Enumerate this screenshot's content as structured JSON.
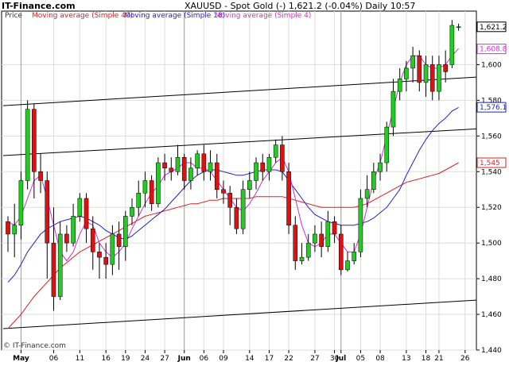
{
  "header": {
    "brand": "IT-Finance.com",
    "title": "XAUUSD - Spot Gold (-)   1,621.2 (-0.04%)   Daily  10:57"
  },
  "legend": {
    "price": "Price",
    "ma40": "Moving average (Simple 40)",
    "ma18": "Moving average (Simple 18)",
    "ma4": "Moving average (Simple 4)"
  },
  "watermark": "© IT-Finance.com",
  "colors": {
    "up": "#22cc22",
    "down": "#dd1111",
    "ma40": "#dd2222",
    "ma18": "#2222cc",
    "ma4": "#cc33cc",
    "channel": "#000000",
    "grid": "#dddddd"
  },
  "chart_data": {
    "type": "candlestick",
    "ylim": [
      1440,
      1630
    ],
    "y_ticks": [
      "1,440",
      "1,460",
      "1,480",
      "1,500",
      "1,520",
      "1,540",
      "1,560",
      "1,580",
      "1,600"
    ],
    "price_labels": {
      "last": "1,621.2",
      "ma4": "1,608.8",
      "ma18": "1,576.1",
      "ma40": "1,545"
    },
    "x_labels": [
      {
        "label": "May",
        "i": 2,
        "bold": true
      },
      {
        "label": "06",
        "i": 7,
        "bold": false
      },
      {
        "label": "11",
        "i": 11,
        "bold": false
      },
      {
        "label": "16",
        "i": 15,
        "bold": false
      },
      {
        "label": "19",
        "i": 18,
        "bold": false
      },
      {
        "label": "24",
        "i": 21,
        "bold": false
      },
      {
        "label": "27",
        "i": 24,
        "bold": false
      },
      {
        "label": "Jun",
        "i": 27,
        "bold": true
      },
      {
        "label": "06",
        "i": 30,
        "bold": false
      },
      {
        "label": "09",
        "i": 33,
        "bold": false
      },
      {
        "label": "14",
        "i": 37,
        "bold": false
      },
      {
        "label": "17",
        "i": 40,
        "bold": false
      },
      {
        "label": "22",
        "i": 43,
        "bold": false
      },
      {
        "label": "27",
        "i": 47,
        "bold": false
      },
      {
        "label": "30",
        "i": 50,
        "bold": false
      },
      {
        "label": "Jul",
        "i": 51,
        "bold": true
      },
      {
        "label": "05",
        "i": 54,
        "bold": false
      },
      {
        "label": "08",
        "i": 57,
        "bold": false
      },
      {
        "label": "13",
        "i": 61,
        "bold": false
      },
      {
        "label": "18",
        "i": 64,
        "bold": false
      },
      {
        "label": "21",
        "i": 66,
        "bold": false
      },
      {
        "label": "26",
        "i": 70,
        "bold": false
      }
    ],
    "candles": [
      [
        1512,
        1505,
        1515,
        1495
      ],
      [
        1505,
        1510,
        1522,
        1492
      ],
      [
        1510,
        1535,
        1540,
        1502
      ],
      [
        1535,
        1575,
        1580,
        1530
      ],
      [
        1575,
        1540,
        1578,
        1525
      ],
      [
        1540,
        1535,
        1550,
        1528
      ],
      [
        1535,
        1500,
        1540,
        1480
      ],
      [
        1500,
        1470,
        1520,
        1462
      ],
      [
        1470,
        1505,
        1512,
        1468
      ],
      [
        1505,
        1500,
        1510,
        1495
      ],
      [
        1500,
        1515,
        1522,
        1498
      ],
      [
        1515,
        1525,
        1528,
        1512
      ],
      [
        1525,
        1508,
        1528,
        1500
      ],
      [
        1508,
        1495,
        1515,
        1485
      ],
      [
        1495,
        1492,
        1500,
        1480
      ],
      [
        1492,
        1488,
        1500,
        1480
      ],
      [
        1488,
        1505,
        1510,
        1482
      ],
      [
        1505,
        1498,
        1512,
        1485
      ],
      [
        1498,
        1515,
        1518,
        1490
      ],
      [
        1515,
        1520,
        1525,
        1510
      ],
      [
        1520,
        1528,
        1535,
        1515
      ],
      [
        1528,
        1535,
        1540,
        1520
      ],
      [
        1535,
        1522,
        1538,
        1518
      ],
      [
        1522,
        1545,
        1548,
        1520
      ],
      [
        1545,
        1542,
        1550,
        1535
      ],
      [
        1542,
        1540,
        1548,
        1535
      ],
      [
        1540,
        1548,
        1555,
        1538
      ],
      [
        1548,
        1535,
        1550,
        1530
      ],
      [
        1535,
        1542,
        1548,
        1530
      ],
      [
        1542,
        1550,
        1552,
        1538
      ],
      [
        1550,
        1540,
        1555,
        1535
      ],
      [
        1540,
        1545,
        1552,
        1535
      ],
      [
        1545,
        1530,
        1550,
        1525
      ],
      [
        1530,
        1528,
        1535,
        1522
      ],
      [
        1528,
        1520,
        1532,
        1510
      ],
      [
        1520,
        1508,
        1525,
        1505
      ],
      [
        1508,
        1530,
        1535,
        1505
      ],
      [
        1530,
        1535,
        1540,
        1525
      ],
      [
        1535,
        1545,
        1548,
        1530
      ],
      [
        1545,
        1540,
        1550,
        1535
      ],
      [
        1540,
        1548,
        1550,
        1535
      ],
      [
        1548,
        1555,
        1558,
        1545
      ],
      [
        1555,
        1540,
        1560,
        1535
      ],
      [
        1540,
        1510,
        1545,
        1505
      ],
      [
        1510,
        1490,
        1515,
        1485
      ],
      [
        1490,
        1492,
        1500,
        1488
      ],
      [
        1492,
        1500,
        1505,
        1490
      ],
      [
        1500,
        1505,
        1510,
        1495
      ],
      [
        1505,
        1498,
        1512,
        1492
      ],
      [
        1498,
        1512,
        1518,
        1495
      ],
      [
        1512,
        1505,
        1515,
        1500
      ],
      [
        1505,
        1485,
        1510,
        1482
      ],
      [
        1485,
        1490,
        1495,
        1484
      ],
      [
        1490,
        1495,
        1500,
        1488
      ],
      [
        1495,
        1525,
        1530,
        1492
      ],
      [
        1525,
        1530,
        1538,
        1520
      ],
      [
        1530,
        1540,
        1545,
        1528
      ],
      [
        1540,
        1545,
        1550,
        1535
      ],
      [
        1545,
        1565,
        1568,
        1540
      ],
      [
        1565,
        1585,
        1592,
        1560
      ],
      [
        1585,
        1592,
        1598,
        1580
      ],
      [
        1592,
        1598,
        1602,
        1585
      ],
      [
        1598,
        1605,
        1610,
        1590
      ],
      [
        1605,
        1590,
        1608,
        1585
      ],
      [
        1590,
        1600,
        1605,
        1582
      ],
      [
        1600,
        1585,
        1605,
        1580
      ],
      [
        1585,
        1600,
        1605,
        1580
      ],
      [
        1600,
        1596,
        1608,
        1590
      ],
      [
        1600,
        1622,
        1625,
        1598
      ],
      [
        1621,
        1621.2,
        1623,
        1619
      ]
    ],
    "ma4": [
      1512,
      1510,
      1515,
      1525,
      1535,
      1538,
      1525,
      1510,
      1495,
      1490,
      1495,
      1505,
      1512,
      1510,
      1500,
      1495,
      1492,
      1495,
      1500,
      1508,
      1515,
      1522,
      1528,
      1532,
      1538,
      1540,
      1542,
      1545,
      1545,
      1542,
      1542,
      1540,
      1535,
      1530,
      1525,
      1520,
      1518,
      1522,
      1528,
      1535,
      1540,
      1545,
      1548,
      1540,
      1525,
      1510,
      1500,
      1498,
      1500,
      1505,
      1505,
      1500,
      1495,
      1495,
      1505,
      1520,
      1535,
      1545,
      1560,
      1575,
      1590,
      1600,
      1605,
      1605,
      1600,
      1598,
      1598,
      1600,
      1605,
      1609
    ],
    "ma18": [
      1478,
      1482,
      1488,
      1495,
      1500,
      1505,
      1508,
      1510,
      1512,
      1513,
      1514,
      1515,
      1514,
      1512,
      1510,
      1507,
      1505,
      1503,
      1502,
      1504,
      1507,
      1510,
      1513,
      1516,
      1519,
      1523,
      1527,
      1531,
      1535,
      1538,
      1540,
      1541,
      1541,
      1540,
      1539,
      1538,
      1538,
      1539,
      1540,
      1541,
      1541,
      1541,
      1540,
      1535,
      1530,
      1525,
      1520,
      1516,
      1514,
      1512,
      1511,
      1510,
      1510,
      1510,
      1511,
      1512,
      1514,
      1517,
      1520,
      1525,
      1530,
      1538,
      1545,
      1552,
      1558,
      1563,
      1567,
      1570,
      1574,
      1576
    ],
    "ma40": [
      1452,
      1456,
      1460,
      1465,
      1470,
      1474,
      1478,
      1482,
      1486,
      1489,
      1492,
      1495,
      1497,
      1499,
      1501,
      1503,
      1505,
      1507,
      1509,
      1511,
      1513,
      1515,
      1516,
      1517,
      1518,
      1519,
      1520,
      1521,
      1522,
      1522,
      1523,
      1524,
      1524,
      1525,
      1525,
      1525,
      1525,
      1525,
      1526,
      1526,
      1526,
      1526,
      1526,
      1525,
      1524,
      1523,
      1522,
      1521,
      1520,
      1520,
      1520,
      1520,
      1520,
      1520,
      1521,
      1522,
      1524,
      1526,
      1528,
      1530,
      1532,
      1534,
      1535,
      1536,
      1537,
      1538,
      1539,
      1541,
      1543,
      1545
    ],
    "channel_lines": [
      {
        "i0": 0,
        "y0": 1577,
        "i1": 71,
        "y1": 1593
      },
      {
        "i0": 0,
        "y0": 1549,
        "i1": 71,
        "y1": 1564
      },
      {
        "i0": 0,
        "y0": 1452,
        "i1": 71,
        "y1": 1468
      }
    ]
  }
}
